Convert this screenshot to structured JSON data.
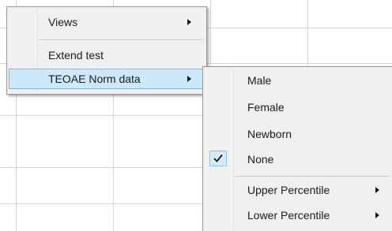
{
  "context_menu": {
    "items": [
      {
        "label": "Views",
        "has_submenu": true
      },
      {
        "label": "Extend test",
        "has_submenu": false
      },
      {
        "label": "TEOAE Norm data",
        "has_submenu": true,
        "highlighted": true
      }
    ]
  },
  "norm_submenu": {
    "items": [
      {
        "label": "Male",
        "checked": false
      },
      {
        "label": "Female",
        "checked": false
      },
      {
        "label": "Newborn",
        "checked": false
      },
      {
        "label": "None",
        "checked": true
      },
      {
        "label": "Upper Percentile",
        "has_submenu": true
      },
      {
        "label": "Lower Percentile",
        "has_submenu": true
      }
    ]
  },
  "colors": {
    "menu_bg": "#f0f0f0",
    "highlight_bg": "#cde8fb",
    "highlight_border": "#7ab7e3",
    "grid_line": "#d6d6d6"
  },
  "icons": {
    "submenu_arrow": "triangle-right",
    "check": "check-mark"
  }
}
